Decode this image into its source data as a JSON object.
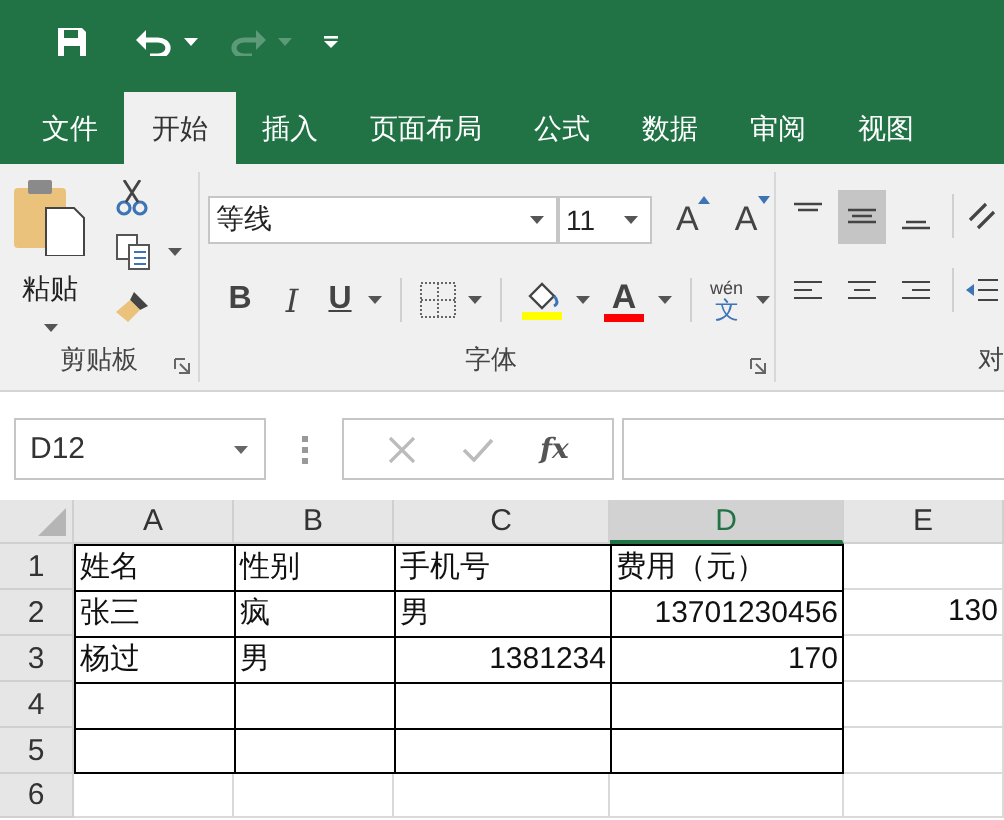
{
  "quick_access": [
    {
      "kind": "save",
      "disabled": false
    },
    {
      "kind": "undo",
      "disabled": false
    },
    {
      "kind": "redo",
      "disabled": true
    },
    {
      "kind": "customize",
      "disabled": false
    }
  ],
  "tabs": [
    {
      "label": "文件",
      "selected": false
    },
    {
      "label": "开始",
      "selected": true
    },
    {
      "label": "插入",
      "selected": false
    },
    {
      "label": "页面布局",
      "selected": false
    },
    {
      "label": "公式",
      "selected": false
    },
    {
      "label": "数据",
      "selected": false
    },
    {
      "label": "审阅",
      "selected": false
    },
    {
      "label": "视图",
      "selected": false
    }
  ],
  "clipboard": {
    "label": "剪贴板",
    "paste_label": "粘贴"
  },
  "font": {
    "label": "字体",
    "font_name": "等线",
    "font_size": "11",
    "grow_label": "A",
    "shrink_label": "A",
    "bold_label": "B",
    "italic_label": "I",
    "underline_label": "U",
    "font_color_label": "A",
    "phonetic_top": "wén",
    "phonetic_bottom": "文"
  },
  "alignment": {
    "label": "对",
    "vertical": [
      {
        "selected": false
      },
      {
        "selected": true
      },
      {
        "selected": false
      }
    ]
  },
  "name_box": {
    "value": "D12"
  },
  "formula_bar": {
    "function_label": "fx"
  },
  "sheet": {
    "columns": [
      {
        "label": "A",
        "selected": false
      },
      {
        "label": "B",
        "selected": false
      },
      {
        "label": "C",
        "selected": false
      },
      {
        "label": "D",
        "selected": true
      },
      {
        "label": "E",
        "selected": false
      }
    ],
    "rows": [
      {
        "label": "1",
        "cells": [
          {
            "text": "姓名",
            "kind": "text",
            "bordered": true
          },
          {
            "text": "性别",
            "kind": "text",
            "bordered": true
          },
          {
            "text": "手机号",
            "kind": "text",
            "bordered": true
          },
          {
            "text": "费用（元）",
            "kind": "text",
            "bordered": true
          },
          {
            "bordered": false
          }
        ]
      },
      {
        "label": "2",
        "cells": [
          {
            "text": "张三",
            "kind": "text",
            "bordered": true
          },
          {
            "text": "疯",
            "kind": "text",
            "bordered": true
          },
          {
            "text": "男",
            "kind": "text",
            "bordered": true
          },
          {
            "text": "13701230456",
            "kind": "number",
            "bordered": true
          },
          {
            "text": "130",
            "kind": "number",
            "bordered": false
          }
        ]
      },
      {
        "label": "3",
        "cells": [
          {
            "text": "杨过",
            "kind": "text",
            "bordered": true
          },
          {
            "text": "男",
            "kind": "text",
            "bordered": true
          },
          {
            "text": "1381234",
            "kind": "number",
            "bordered": true
          },
          {
            "text": "170",
            "kind": "number",
            "bordered": true
          },
          {
            "bordered": false
          }
        ]
      },
      {
        "label": "4",
        "cells": [
          {
            "bordered": true
          },
          {
            "bordered": true
          },
          {
            "bordered": true
          },
          {
            "bordered": true
          },
          {
            "bordered": false
          }
        ]
      },
      {
        "label": "5",
        "cells": [
          {
            "bordered": true
          },
          {
            "bordered": true
          },
          {
            "bordered": true
          },
          {
            "bordered": true
          },
          {
            "bordered": false
          }
        ]
      },
      {
        "label": "6",
        "cells": [
          {
            "bordered": false
          },
          {
            "bordered": false
          },
          {
            "bordered": false
          },
          {
            "bordered": false
          },
          {
            "bordered": false
          }
        ]
      }
    ]
  }
}
